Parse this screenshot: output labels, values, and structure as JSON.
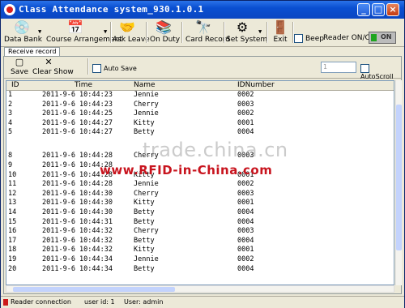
{
  "window": {
    "title": "Class Attendance system_930.1.0.1",
    "minimize": "_",
    "maximize": "□",
    "close": "×"
  },
  "toolbar": {
    "data_bank": "Data Bank",
    "course_arrangement": "Course Arrangement",
    "ask_leave": "Ask Leave",
    "on_duty": "On Duty",
    "card_record": "Card Record",
    "set_system": "Set System",
    "exit": "Exit",
    "beep": "Beep",
    "reader_onoff": "Reader ON/OFF",
    "on_button": "ON"
  },
  "tab": {
    "label": "Receive record"
  },
  "subtoolbar": {
    "save": "Save",
    "clear_show": "Clear Show",
    "auto_save": "Auto Save",
    "count_value": "1",
    "auto_scroll": "AutoScroll"
  },
  "grid": {
    "headers": [
      "ID",
      "Time",
      "Name",
      "IDNumber"
    ],
    "rows": [
      [
        "1",
        "2011-9-6 10:44:23",
        "Jennie",
        "0002"
      ],
      [
        "2",
        "2011-9-6 10:44:23",
        "Cherry",
        "0003"
      ],
      [
        "3",
        "2011-9-6 10:44:25",
        "Jennie",
        "0002"
      ],
      [
        "4",
        "2011-9-6 10:44:27",
        "Kitty",
        "0001"
      ],
      [
        "5",
        "2011-9-6 10:44:27",
        "Betty",
        "0004"
      ],
      [
        "8",
        "2011-9-6 10:44:28",
        "Cherry",
        "0003"
      ],
      [
        "9",
        "2011-9-6 10:44:28",
        "",
        ""
      ],
      [
        "10",
        "2011-9-6 10:44:28",
        "Kitty",
        "0001"
      ],
      [
        "11",
        "2011-9-6 10:44:28",
        "Jennie",
        "0002"
      ],
      [
        "12",
        "2011-9-6 10:44:30",
        "Cherry",
        "0003"
      ],
      [
        "13",
        "2011-9-6 10:44:30",
        "Kitty",
        "0001"
      ],
      [
        "14",
        "2011-9-6 10:44:30",
        "Betty",
        "0004"
      ],
      [
        "15",
        "2011-9-6 10:44:31",
        "Betty",
        "0004"
      ],
      [
        "16",
        "2011-9-6 10:44:32",
        "Cherry",
        "0003"
      ],
      [
        "17",
        "2011-9-6 10:44:32",
        "Betty",
        "0004"
      ],
      [
        "18",
        "2011-9-6 10:44:32",
        "Kitty",
        "0001"
      ],
      [
        "19",
        "2011-9-6 10:44:34",
        "Jennie",
        "0002"
      ],
      [
        "20",
        "2011-9-6 10:44:34",
        "Betty",
        "0004"
      ]
    ]
  },
  "status": {
    "connection": "Reader connection",
    "user_id": "user id: 1",
    "user": "User: admin"
  },
  "watermark": {
    "line1": "trade.china.cn",
    "line2": "www.RFID-in-China.com"
  },
  "icons": {
    "data_bank": "disc-icon",
    "course_arrangement": "calendar-icon",
    "ask_leave": "handshake-icon",
    "on_duty": "books-icon",
    "card_record": "binoculars-icon",
    "set_system": "gear-icon",
    "exit": "exit-icon",
    "save": "save-icon",
    "clear_show": "clear-icon"
  }
}
